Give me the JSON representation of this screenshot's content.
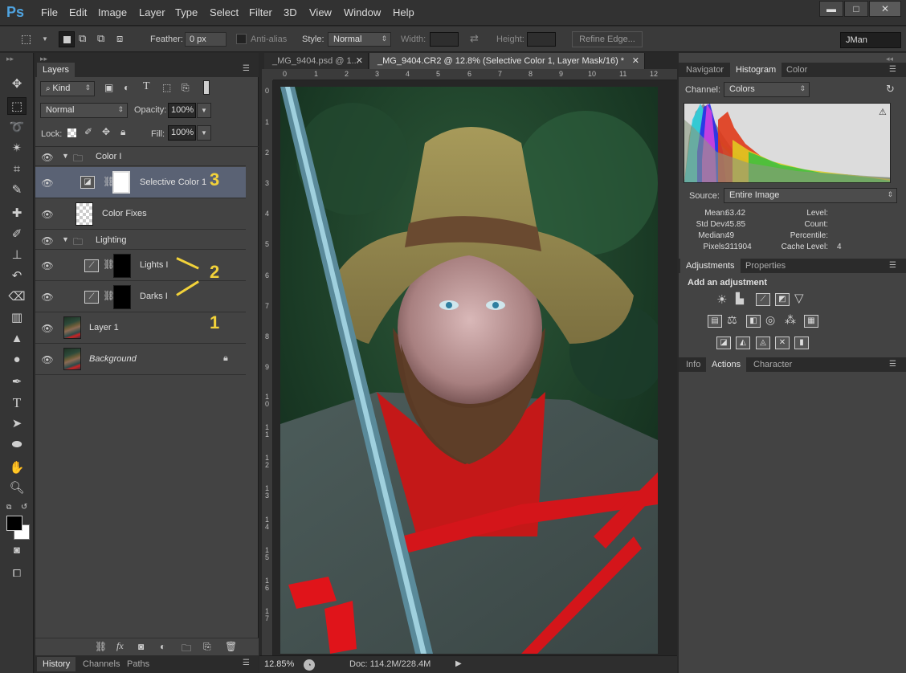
{
  "app": {
    "logo": "Ps",
    "workspace": "JMan"
  },
  "menu": [
    "File",
    "Edit",
    "Image",
    "Layer",
    "Type",
    "Select",
    "Filter",
    "3D",
    "View",
    "Window",
    "Help"
  ],
  "window_controls": {
    "minimize": "▬",
    "maximize": "□",
    "close": "✕"
  },
  "options": {
    "feather_label": "Feather:",
    "feather_value": "0 px",
    "antialias_label": "Anti-alias",
    "style_label": "Style:",
    "style_value": "Normal",
    "width_label": "Width:",
    "height_label": "Height:",
    "refine_edge": "Refine Edge..."
  },
  "layers_panel": {
    "tabs": [
      "Layers"
    ],
    "filter_kind": "Kind",
    "blend_mode": "Normal",
    "opacity_label": "Opacity:",
    "opacity_value": "100%",
    "lock_label": "Lock:",
    "fill_label": "Fill:",
    "fill_value": "100%",
    "layers": [
      {
        "name": "Color I",
        "kind": "group"
      },
      {
        "name": "Selective Color 1",
        "kind": "adjustment",
        "mask": "white"
      },
      {
        "name": "Color Fixes",
        "kind": "empty"
      },
      {
        "name": "Lighting",
        "kind": "group"
      },
      {
        "name": "Lights I",
        "kind": "curves",
        "mask": "black"
      },
      {
        "name": "Darks I",
        "kind": "curves",
        "mask": "black"
      },
      {
        "name": "Layer 1",
        "kind": "photo"
      },
      {
        "name": "Background",
        "kind": "photo",
        "locked": true
      }
    ],
    "annotations": {
      "three": "3",
      "two": "2",
      "one": "1"
    },
    "bottom_tabs": [
      "History",
      "Channels",
      "Paths"
    ]
  },
  "document": {
    "tabs": [
      "_MG_9404.psd @ 1...",
      "_MG_9404.CR2 @ 12.8% (Selective Color 1, Layer Mask/16) *"
    ],
    "ruler_h": [
      "0",
      "1",
      "2",
      "3",
      "4",
      "5",
      "6",
      "7",
      "8",
      "9",
      "10",
      "11",
      "12"
    ],
    "ruler_v": [
      "0",
      "1",
      "2",
      "3",
      "4",
      "5",
      "6",
      "7",
      "8",
      "9",
      "1\n0",
      "1\n1",
      "1\n2",
      "1\n3",
      "1\n4",
      "1\n5",
      "1\n6",
      "1\n7"
    ],
    "zoom": "12.85%",
    "doc_info": "Doc: 114.2M/228.4M"
  },
  "histogram_panel": {
    "tabs": [
      "Navigator",
      "Histogram",
      "Color"
    ],
    "channel_label": "Channel:",
    "channel_value": "Colors",
    "source_label": "Source:",
    "source_value": "Entire Image",
    "mean_label": "Mean:",
    "mean_value": "63.42",
    "stddev_label": "Std Dev:",
    "stddev_value": "45.85",
    "median_label": "Median:",
    "median_value": "49",
    "pixels_label": "Pixels:",
    "pixels_value": "311904",
    "level_label": "Level:",
    "count_label": "Count:",
    "percentile_label": "Percentile:",
    "cache_label": "Cache Level:",
    "cache_value": "4"
  },
  "adjustments_panel": {
    "tabs": [
      "Adjustments",
      "Properties"
    ],
    "heading": "Add an adjustment"
  },
  "info_panel": {
    "tabs": [
      "Info",
      "Actions",
      "Character"
    ]
  }
}
